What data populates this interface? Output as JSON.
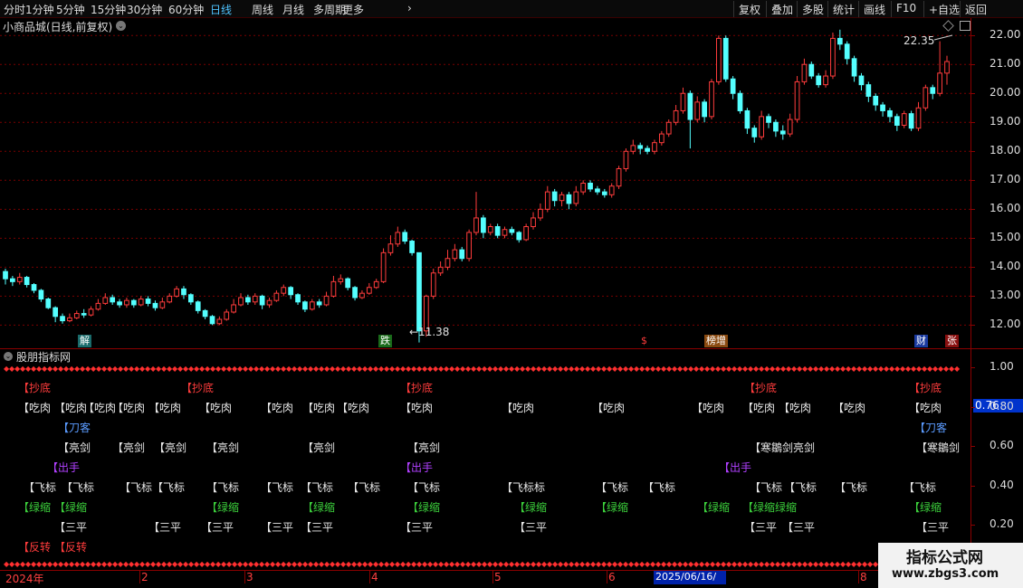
{
  "toolbar": {
    "periods": [
      "分时",
      "1分钟",
      "5分钟",
      "15分钟",
      "30分钟",
      "60分钟",
      "日线",
      "周线",
      "月线",
      "多周期",
      "更多"
    ],
    "active_period": "日线",
    "right_buttons": [
      "复权",
      "叠加",
      "多股",
      "统计",
      "画线",
      "F10",
      "+自选",
      "返回"
    ]
  },
  "chart": {
    "title": "小商品城(日线,前复权)",
    "high_label": "22.35",
    "low_label": "11.38",
    "y_labels": [
      "22.00",
      "21.00",
      "20.00",
      "19.00",
      "18.00",
      "17.00",
      "16.00",
      "15.00",
      "14.00",
      "13.00",
      "12.00"
    ]
  },
  "events": [
    "解",
    "跌",
    "$",
    "榜增",
    "财",
    "张"
  ],
  "indicator": {
    "title": "股朋指标网",
    "y_labels": [
      "1.00",
      "0.80",
      "0.60",
      "0.40",
      "0.20"
    ],
    "current_value": "0.76",
    "signals": {
      "chaodi": "【抄底",
      "chirou": "【吃肉",
      "daoke": "【刀客",
      "liangjian": "【亮剑",
      "chushou": "【出手",
      "feibiao": "【飞标",
      "lvsuo": "【绿缩",
      "sanping": "【三平",
      "fanzhuan": "【反转",
      "feibiaobiao": "【飞标标",
      "hanjianliangjian": "【寒鶵剑亮剑",
      "hanjian": "【寒鶵剑",
      "lvsuolvsuo": "【绿缩绿缩"
    }
  },
  "datebar": {
    "labels": [
      "2024年",
      "2",
      "3",
      "4",
      "5",
      "6",
      "8"
    ],
    "cursor_date": "2025/06/16/—"
  },
  "watermark": {
    "line1": "指标公式网",
    "line2": "www.zbgs3.com"
  },
  "colors": {
    "up": "#ff3c3c",
    "down": "#54ffff",
    "grid": "#8b0000",
    "accent": "#4fc3ff"
  },
  "chart_data": {
    "type": "candlestick",
    "title": "小商品城(日线,前复权)",
    "ylim": [
      11.2,
      22.6
    ],
    "candles": [
      [
        13.85,
        13.6,
        13.95,
        13.4
      ],
      [
        13.6,
        13.5,
        13.7,
        13.35
      ],
      [
        13.5,
        13.65,
        13.8,
        13.4
      ],
      [
        13.65,
        13.4,
        13.7,
        13.3
      ],
      [
        13.4,
        13.2,
        13.45,
        13.1
      ],
      [
        13.2,
        12.9,
        13.25,
        12.8
      ],
      [
        12.9,
        12.6,
        12.95,
        12.55
      ],
      [
        12.6,
        12.3,
        12.65,
        12.1
      ],
      [
        12.3,
        12.15,
        12.4,
        12.05
      ],
      [
        12.15,
        12.25,
        12.4,
        12.1
      ],
      [
        12.25,
        12.4,
        12.5,
        12.2
      ],
      [
        12.4,
        12.35,
        12.55,
        12.25
      ],
      [
        12.35,
        12.55,
        12.65,
        12.3
      ],
      [
        12.55,
        12.75,
        12.9,
        12.5
      ],
      [
        12.75,
        12.95,
        13.1,
        12.7
      ],
      [
        12.95,
        12.8,
        13.05,
        12.7
      ],
      [
        12.8,
        12.7,
        12.9,
        12.6
      ],
      [
        12.7,
        12.85,
        12.95,
        12.6
      ],
      [
        12.85,
        12.7,
        12.9,
        12.6
      ],
      [
        12.7,
        12.9,
        13.0,
        12.65
      ],
      [
        12.9,
        12.75,
        13.0,
        12.65
      ],
      [
        12.75,
        12.6,
        12.85,
        12.5
      ],
      [
        12.6,
        12.8,
        12.95,
        12.55
      ],
      [
        12.8,
        13.0,
        13.1,
        12.75
      ],
      [
        13.0,
        13.25,
        13.35,
        12.95
      ],
      [
        13.25,
        13.05,
        13.35,
        12.9
      ],
      [
        13.05,
        12.8,
        13.1,
        12.7
      ],
      [
        12.8,
        12.5,
        12.85,
        12.4
      ],
      [
        12.5,
        12.3,
        12.55,
        12.2
      ],
      [
        12.3,
        12.05,
        12.35,
        12.0
      ],
      [
        12.05,
        12.2,
        12.3,
        12.0
      ],
      [
        12.2,
        12.45,
        12.55,
        12.15
      ],
      [
        12.45,
        12.7,
        12.9,
        12.4
      ],
      [
        12.7,
        12.95,
        13.1,
        12.65
      ],
      [
        12.95,
        12.8,
        13.05,
        12.7
      ],
      [
        12.8,
        13.0,
        13.1,
        12.7
      ],
      [
        13.0,
        12.7,
        13.05,
        12.55
      ],
      [
        12.7,
        12.85,
        12.95,
        12.6
      ],
      [
        12.85,
        13.1,
        13.2,
        12.8
      ],
      [
        13.1,
        13.3,
        13.4,
        13.0
      ],
      [
        13.3,
        13.05,
        13.35,
        12.9
      ],
      [
        13.05,
        12.8,
        13.1,
        12.7
      ],
      [
        12.8,
        12.55,
        12.85,
        12.45
      ],
      [
        12.55,
        12.8,
        12.9,
        12.5
      ],
      [
        12.8,
        12.7,
        12.9,
        12.6
      ],
      [
        12.7,
        13.0,
        13.15,
        12.65
      ],
      [
        13.0,
        13.5,
        13.7,
        12.95
      ],
      [
        13.5,
        13.6,
        13.75,
        13.4
      ],
      [
        13.6,
        13.3,
        13.65,
        13.2
      ],
      [
        13.3,
        12.95,
        13.35,
        12.85
      ],
      [
        12.95,
        13.1,
        13.2,
        12.9
      ],
      [
        13.1,
        13.3,
        13.45,
        13.05
      ],
      [
        13.3,
        13.5,
        13.6,
        13.25
      ],
      [
        13.5,
        14.5,
        14.65,
        13.45
      ],
      [
        14.5,
        14.8,
        15.1,
        14.4
      ],
      [
        14.8,
        15.2,
        15.4,
        14.7
      ],
      [
        15.2,
        14.9,
        15.3,
        14.8
      ],
      [
        14.9,
        14.5,
        14.95,
        14.4
      ],
      [
        14.5,
        11.8,
        12.2,
        11.4
      ],
      [
        11.8,
        13.0,
        13.05,
        11.6
      ],
      [
        13.0,
        13.8,
        13.95,
        12.9
      ],
      [
        13.8,
        14.0,
        14.2,
        13.7
      ],
      [
        14.0,
        14.3,
        14.6,
        13.9
      ],
      [
        14.3,
        14.6,
        14.8,
        14.2
      ],
      [
        14.6,
        14.3,
        14.7,
        14.2
      ],
      [
        14.3,
        15.2,
        15.3,
        14.2
      ],
      [
        15.2,
        15.7,
        16.6,
        15.1
      ],
      [
        15.7,
        15.2,
        15.8,
        15.0
      ],
      [
        15.2,
        15.4,
        15.5,
        15.1
      ],
      [
        15.4,
        15.1,
        15.5,
        15.0
      ],
      [
        15.1,
        15.3,
        15.4,
        15.0
      ],
      [
        15.3,
        15.2,
        15.4,
        15.1
      ],
      [
        15.2,
        14.95,
        15.25,
        14.85
      ],
      [
        14.95,
        15.4,
        15.5,
        14.9
      ],
      [
        15.4,
        15.7,
        15.9,
        15.3
      ],
      [
        15.7,
        16.0,
        16.2,
        15.6
      ],
      [
        16.0,
        16.6,
        16.8,
        15.9
      ],
      [
        16.6,
        16.3,
        16.7,
        16.1
      ],
      [
        16.3,
        16.5,
        16.6,
        16.1
      ],
      [
        16.5,
        16.2,
        16.6,
        16.0
      ],
      [
        16.2,
        16.6,
        16.8,
        16.1
      ],
      [
        16.6,
        16.9,
        17.0,
        16.5
      ],
      [
        16.9,
        16.7,
        17.0,
        16.6
      ],
      [
        16.7,
        16.6,
        16.8,
        16.5
      ],
      [
        16.6,
        16.5,
        16.7,
        16.4
      ],
      [
        16.5,
        16.8,
        16.9,
        16.4
      ],
      [
        16.8,
        17.4,
        17.5,
        16.7
      ],
      [
        17.4,
        18.0,
        18.1,
        17.3
      ],
      [
        18.0,
        18.2,
        18.4,
        17.9
      ],
      [
        18.2,
        18.1,
        18.3,
        17.9
      ],
      [
        18.1,
        18.0,
        18.2,
        17.9
      ],
      [
        18.0,
        18.3,
        18.4,
        17.9
      ],
      [
        18.3,
        18.6,
        18.7,
        18.2
      ],
      [
        18.6,
        19.0,
        19.1,
        18.5
      ],
      [
        19.0,
        19.4,
        19.6,
        18.9
      ],
      [
        19.4,
        20.0,
        20.2,
        19.3
      ],
      [
        20.0,
        19.1,
        20.1,
        18.1
      ],
      [
        19.1,
        19.7,
        19.9,
        19.0
      ],
      [
        19.7,
        19.2,
        19.8,
        19.0
      ],
      [
        19.2,
        20.4,
        20.5,
        19.1
      ],
      [
        20.4,
        21.9,
        22.0,
        20.3
      ],
      [
        21.9,
        20.5,
        22.0,
        20.4
      ],
      [
        20.5,
        20.0,
        20.6,
        19.8
      ],
      [
        20.0,
        19.4,
        20.1,
        19.3
      ],
      [
        19.4,
        18.8,
        19.5,
        18.6
      ],
      [
        18.8,
        18.5,
        18.9,
        18.3
      ],
      [
        18.5,
        19.2,
        19.4,
        18.4
      ],
      [
        19.2,
        19.0,
        19.3,
        18.8
      ],
      [
        19.0,
        18.7,
        19.1,
        18.5
      ],
      [
        18.7,
        18.6,
        18.9,
        18.4
      ],
      [
        18.6,
        19.1,
        19.3,
        18.5
      ],
      [
        19.1,
        20.4,
        20.6,
        19.0
      ],
      [
        20.4,
        21.0,
        21.2,
        20.3
      ],
      [
        21.0,
        20.6,
        21.1,
        20.5
      ],
      [
        20.6,
        20.3,
        20.7,
        20.2
      ],
      [
        20.3,
        20.6,
        20.8,
        20.2
      ],
      [
        20.6,
        21.9,
        22.1,
        20.5
      ],
      [
        21.9,
        21.7,
        22.2,
        21.5
      ],
      [
        21.7,
        21.2,
        21.8,
        21.0
      ],
      [
        21.2,
        20.6,
        21.3,
        20.4
      ],
      [
        20.6,
        20.3,
        20.7,
        20.1
      ],
      [
        20.3,
        19.9,
        20.4,
        19.7
      ],
      [
        19.9,
        19.6,
        20.0,
        19.4
      ],
      [
        19.6,
        19.4,
        19.7,
        19.2
      ],
      [
        19.4,
        19.2,
        19.5,
        19.0
      ],
      [
        19.2,
        18.9,
        19.3,
        18.7
      ],
      [
        18.9,
        19.3,
        19.4,
        18.8
      ],
      [
        19.3,
        18.8,
        19.4,
        18.7
      ],
      [
        18.8,
        19.5,
        19.7,
        18.7
      ],
      [
        19.5,
        20.2,
        20.3,
        19.4
      ],
      [
        20.2,
        20.0,
        20.3,
        19.8
      ],
      [
        20.0,
        20.7,
        21.8,
        19.9
      ],
      [
        20.7,
        21.1,
        21.3,
        20.3
      ]
    ]
  }
}
